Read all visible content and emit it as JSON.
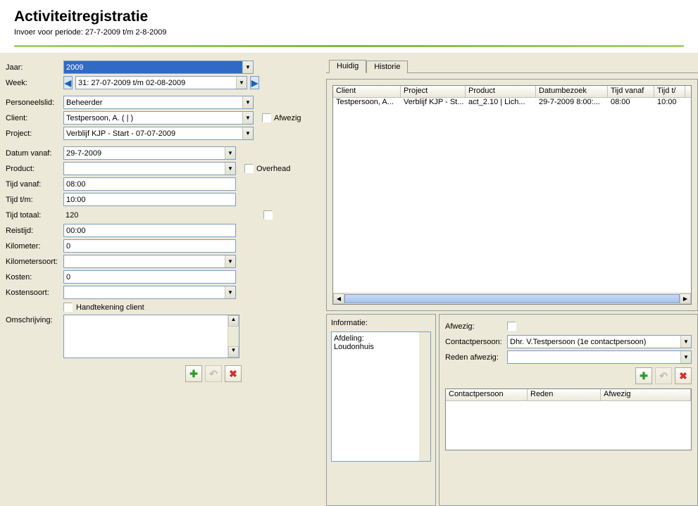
{
  "header": {
    "title": "Activiteitregistratie",
    "subtitle": "Invoer voor periode: 27-7-2009 t/m 2-8-2009"
  },
  "form": {
    "year_label": "Jaar:",
    "year_value": "2009",
    "week_label": "Week:",
    "week_value": "31: 27-07-2009 t/m 02-08-2009",
    "pers_label": "Personeelslid:",
    "pers_value": "Beheerder",
    "client_label": "Client:",
    "client_value": "Testpersoon, A. ( | )",
    "afwezig_label": "Afwezig",
    "project_label": "Project:",
    "project_value": "Verblijf KJP - Start - 07-07-2009",
    "datumvanaf_label": "Datum vanaf:",
    "datumvanaf_value": "29-7-2009",
    "product_label": "Product:",
    "product_value": "",
    "overhead_label": "Overhead",
    "tijdvanaf_label": "Tijd vanaf:",
    "tijdvanaf_value": "08:00",
    "tijdtm_label": "Tijd t/m:",
    "tijdtm_value": "10:00",
    "tijdtotaal_label": "Tijd totaal:",
    "tijdtotaal_value": "120",
    "reistijd_label": "Reistijd:",
    "reistijd_value": "00:00",
    "km_label": "Kilometer:",
    "km_value": "0",
    "kmsoort_label": "Kilometersoort:",
    "kmsoort_value": "",
    "kosten_label": "Kosten:",
    "kosten_value": "0",
    "kostensoort_label": "Kostensoort:",
    "kostensoort_value": "",
    "handtekening_label": "Handtekening client",
    "omschrijving_label": "Omschrijving:"
  },
  "tabs": {
    "huidig": "Huidig",
    "historie": "Historie"
  },
  "grid": {
    "headers": {
      "client": "Client",
      "project": "Project",
      "product": "Product",
      "datum": "Datumbezoek",
      "tijdvanaf": "Tijd vanaf",
      "tijdtm": "Tijd t/"
    },
    "rows": [
      {
        "client": "Testpersoon, A...",
        "project": "Verblijf KJP - St...",
        "product": "act_2.10 | Lich...",
        "datum": "29-7-2009 8:00:...",
        "tijdvanaf": "08:00",
        "tijdtm": "10:00"
      }
    ]
  },
  "info": {
    "label": "Informatie:",
    "afdeling_label": "Afdeling:",
    "afdeling_value": "Loudonhuis"
  },
  "contact": {
    "afwezig_label": "Afwezig:",
    "contactpersoon_label": "Contactpersoon:",
    "contactpersoon_value": "Dhr. V.Testpersoon (1e contactpersoon)",
    "redenafwezig_label": "Reden afwezig:",
    "redenafwezig_value": "",
    "grid_headers": {
      "cp": "Contactpersoon",
      "reden": "Reden",
      "afwezig": "Afwezig"
    }
  }
}
